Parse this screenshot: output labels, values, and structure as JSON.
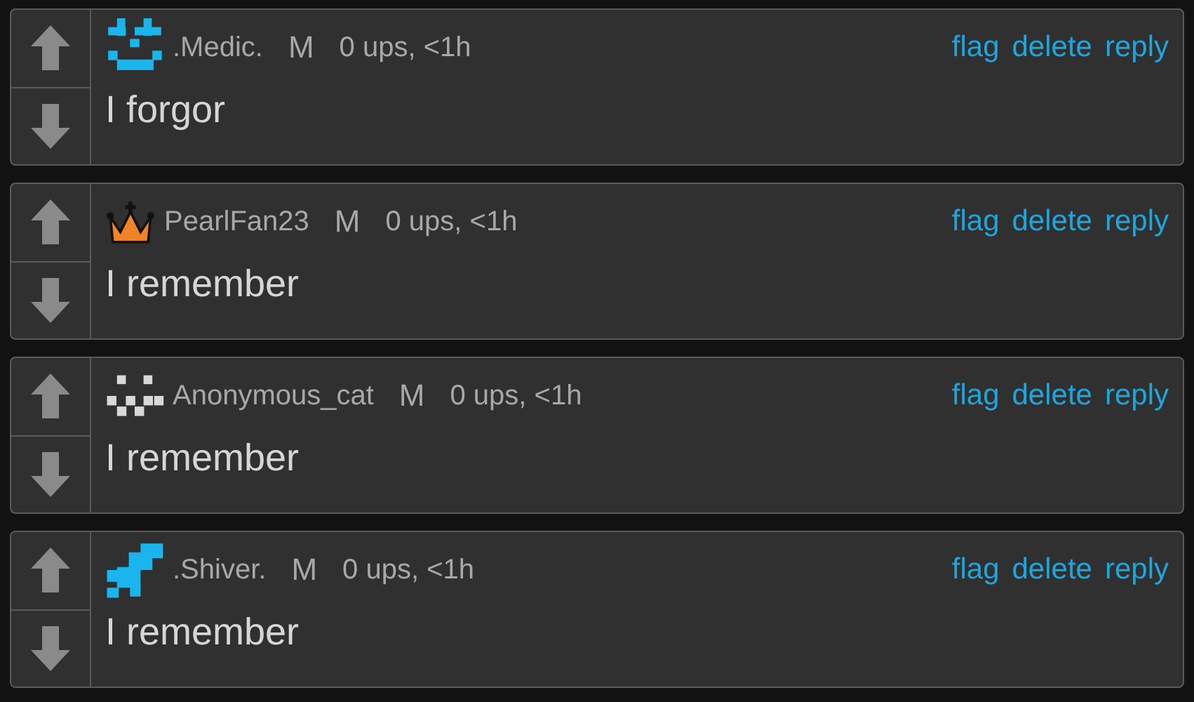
{
  "comments": [
    {
      "kind": "smiley",
      "username": ".Medic.",
      "badge": "M",
      "meta": "0 ups, <1h",
      "actions": [
        "flag",
        "delete",
        "reply"
      ],
      "text": "I forgor"
    },
    {
      "kind": "crown",
      "username": "PearlFan23",
      "badge": "M",
      "meta": "0 ups, <1h",
      "actions": [
        "flag",
        "delete",
        "reply"
      ],
      "text": "I remember"
    },
    {
      "kind": "checker",
      "username": "Anonymous_cat",
      "badge": "M",
      "meta": "0 ups, <1h",
      "actions": [
        "flag",
        "delete",
        "reply"
      ],
      "text": "I remember"
    },
    {
      "kind": "stairs",
      "username": ".Shiver.",
      "badge": "M",
      "meta": "0 ups, <1h",
      "actions": [
        "flag",
        "delete",
        "reply"
      ],
      "text": "I remember"
    }
  ]
}
